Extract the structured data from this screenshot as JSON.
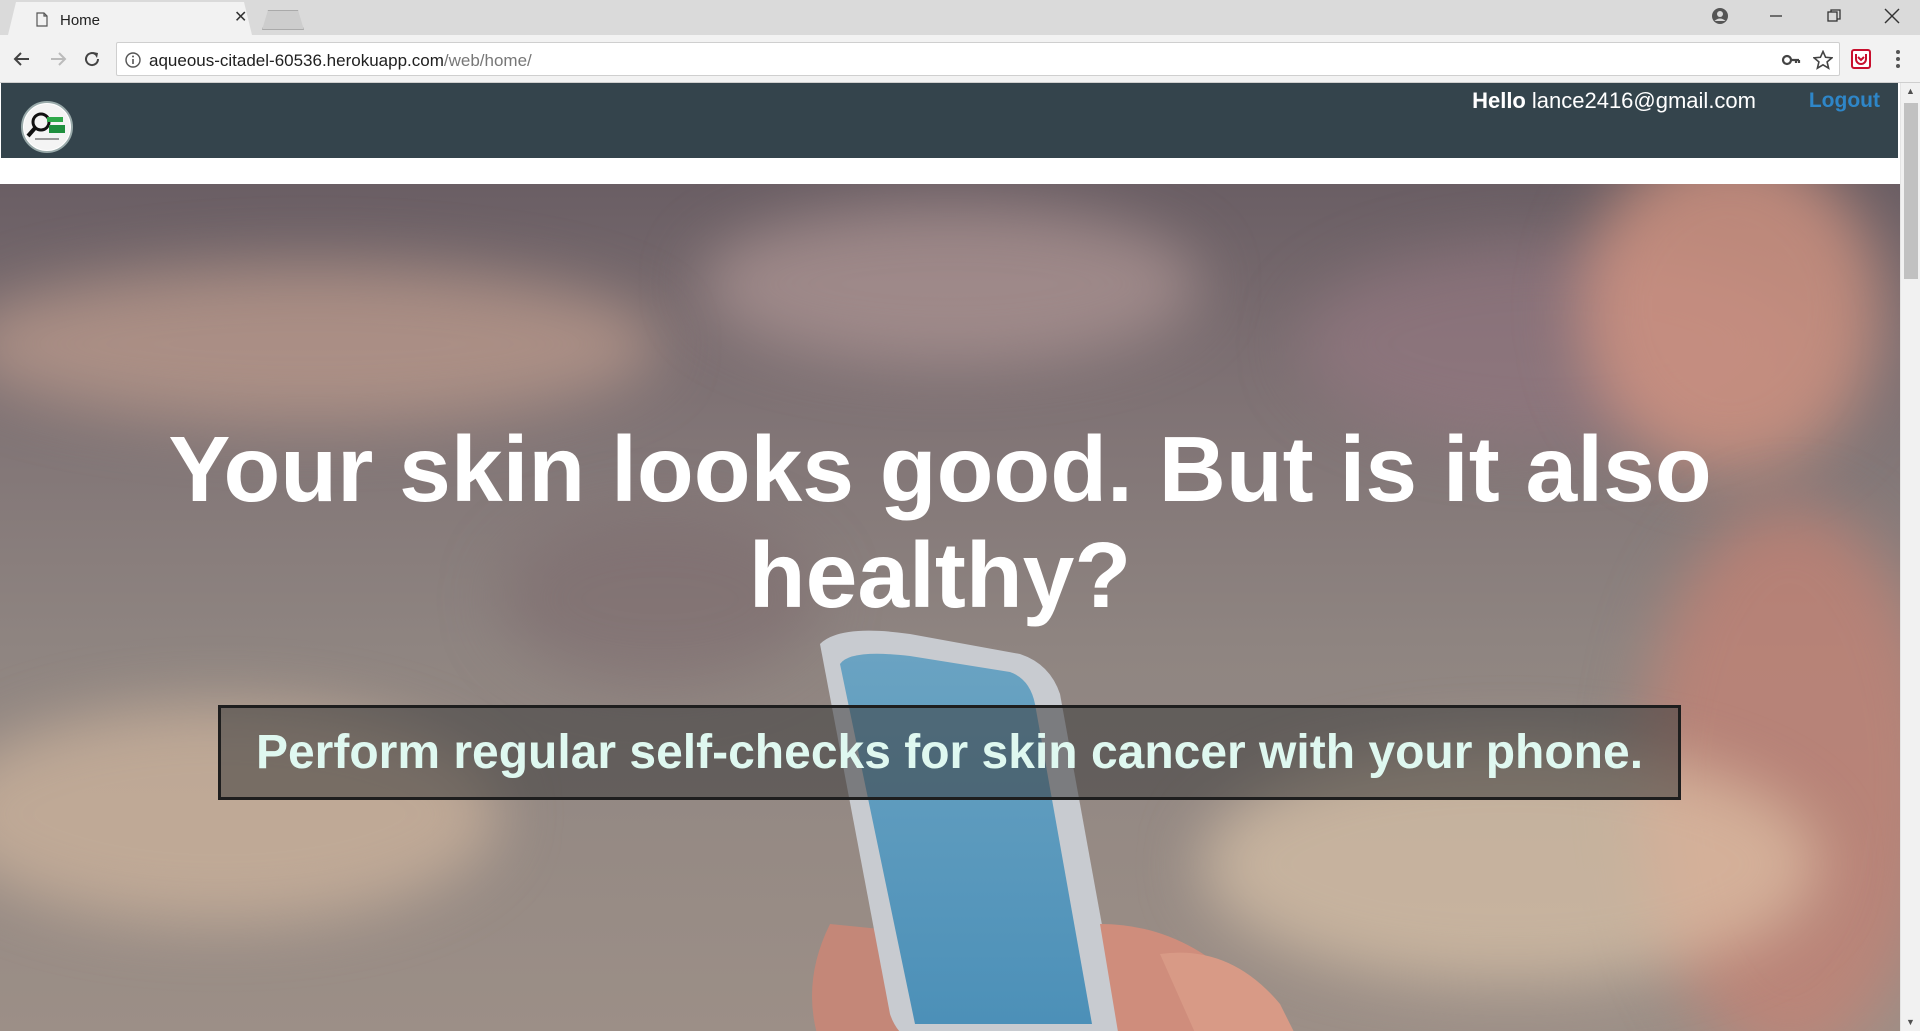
{
  "browser": {
    "tab_title": "Home",
    "url_host": "aqueous-citadel-60536.herokuapp.com",
    "url_path": "/web/home/"
  },
  "header": {
    "greeting": "Hello",
    "user_email": "lance2416@gmail.com",
    "logout_label": "Logout"
  },
  "hero": {
    "title": "Your skin looks good. But is it also healthy?",
    "tagline": "Perform regular self-checks for skin cancer with your phone."
  },
  "colors": {
    "navbar": "#34444c",
    "logout_link": "#2e86c8",
    "tagline_text": "#dff8f0"
  },
  "icons": {
    "tab": "page-icon",
    "back": "back-arrow-icon",
    "forward": "forward-arrow-icon",
    "reload": "reload-icon",
    "info": "info-icon",
    "key": "key-icon",
    "star": "star-icon",
    "extension": "extension-icon",
    "menu": "kebab-menu-icon",
    "account": "account-icon"
  }
}
